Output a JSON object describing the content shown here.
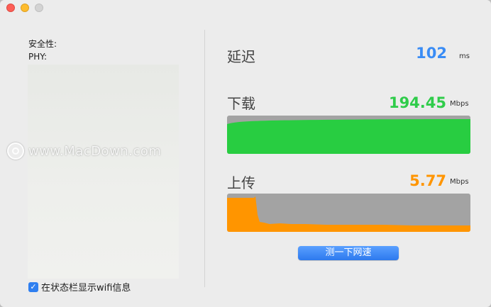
{
  "window": {
    "controls": {
      "close_color": "#fd5e56",
      "minimize_color": "#febc2e",
      "maximize_color": "#d3d3d3"
    }
  },
  "info": {
    "security_label": "安全性:",
    "phy_label": "PHY:"
  },
  "options": {
    "show_in_menubar_label": "在状态栏显示wifi信息",
    "show_in_menubar_checked": true
  },
  "latency": {
    "label": "延迟",
    "value": "102",
    "unit": "ms",
    "color": "#3a8cf5"
  },
  "download": {
    "label": "下载",
    "value": "194.45",
    "unit": "Mbps",
    "color": "#2fcc4a",
    "graph_color": "#28cd41"
  },
  "upload": {
    "label": "上传",
    "value": "5.77",
    "unit": "Mbps",
    "color": "#ff9500",
    "graph_color": "#ff9500"
  },
  "actions": {
    "speed_test_label": "测一下网速"
  },
  "watermark": {
    "text": "www.MacDown.com"
  }
}
